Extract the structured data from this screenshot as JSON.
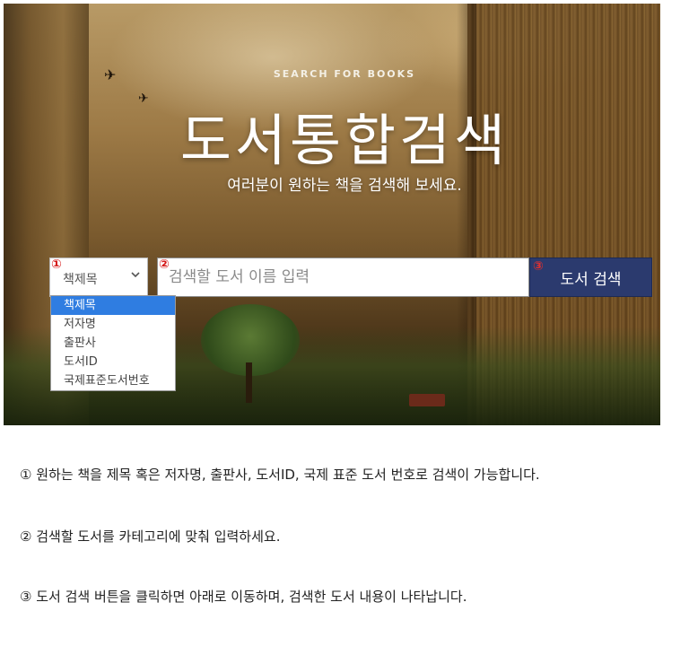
{
  "hero": {
    "overline": "SEARCH FOR BOOKS",
    "title": "도서통합검색",
    "subtitle": "여러분이 원하는 책을 검색해 보세요."
  },
  "search": {
    "markers": [
      "①",
      "②",
      "③"
    ],
    "category_select": {
      "selected": "책제목",
      "options": [
        "책제목",
        "저자명",
        "출판사",
        "도서ID",
        "국제표준도서번호"
      ],
      "highlighted_index": 0
    },
    "input": {
      "value": "",
      "placeholder": "검색할 도서 이름 입력"
    },
    "button_label": "도서 검색"
  },
  "notes": [
    "① 원하는 책을 제목 혹은 저자명, 출판사, 도서ID, 국제 표준 도서 번호로 검색이 가능합니다.",
    "② 검색할 도서를 카테고리에 맞춰 입력하세요.",
    "③ 도서 검색 버튼을 클릭하면 아래로 이동하며, 검색한 도서 내용이 나타납니다."
  ],
  "colors": {
    "button": "#2b3a6e",
    "highlight": "#2f7de1",
    "marker": "#d41414"
  }
}
